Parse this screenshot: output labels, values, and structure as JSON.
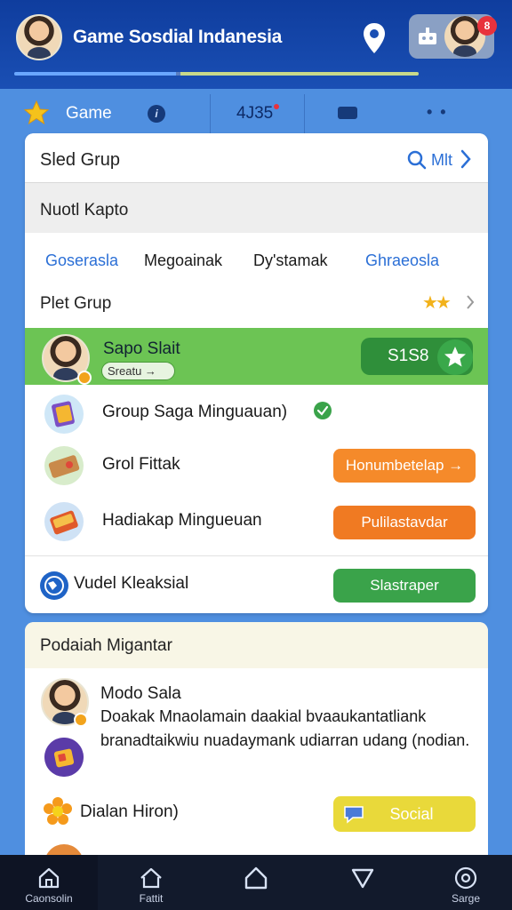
{
  "header": {
    "title": "Game Sosdial Indanesia",
    "notification_count": "8",
    "progress_blue": 0.4,
    "progress_yellow": 0.59
  },
  "tabs": {
    "game_label": "Game",
    "count": "4J35"
  },
  "search": {
    "label": "Sled Grup",
    "more_label": "Mlt"
  },
  "section": {
    "label": "Nuotl Kapto"
  },
  "categories": [
    {
      "label": "Goserasla",
      "color": "#2b6fd6"
    },
    {
      "label": "Megoainak",
      "color": "#1a1a1a"
    },
    {
      "label": "Dy'stamak",
      "color": "#1a1a1a"
    },
    {
      "label": "Ghraeosla",
      "color": "#2b6fd6"
    }
  ],
  "plet": {
    "label": "Plet Grup",
    "stars": "★★"
  },
  "highlight": {
    "name": "Sapo Slait",
    "chip": "Sreatu →",
    "button": "S1S8"
  },
  "rows": [
    {
      "label": "Group Saga Minguauan)"
    },
    {
      "label": "Grol Fittak",
      "button": "Honumbetelap →"
    },
    {
      "label": "Hadiakap Mingueuan",
      "button": "Pulilastavdar"
    },
    {
      "label": "Vudel Kleaksial",
      "button": "Slastraper"
    }
  ],
  "card2": {
    "title": "Podaiah Migantar",
    "name": "Modo Sala",
    "description": "Doakak Mnaolamain daakial bvaaukantatliank branadtaikwiu nuadaymank udiarran udang (nodian.",
    "label": "Dialan Hiron)",
    "button": "Social"
  },
  "nav": [
    {
      "label": "Caonsolin",
      "icon": "home-icon"
    },
    {
      "label": "Fattit",
      "icon": "house-icon"
    },
    {
      "label": "",
      "icon": "home-outline-icon"
    },
    {
      "label": "",
      "icon": "triangle-down-icon"
    },
    {
      "label": "Sarge",
      "icon": "settings-icon"
    }
  ],
  "colors": {
    "header": "#1a4fb4",
    "highlight": "#6cc454",
    "orange": "#f58a2a",
    "green": "#3aa34a",
    "yellow": "#e9d93a"
  }
}
